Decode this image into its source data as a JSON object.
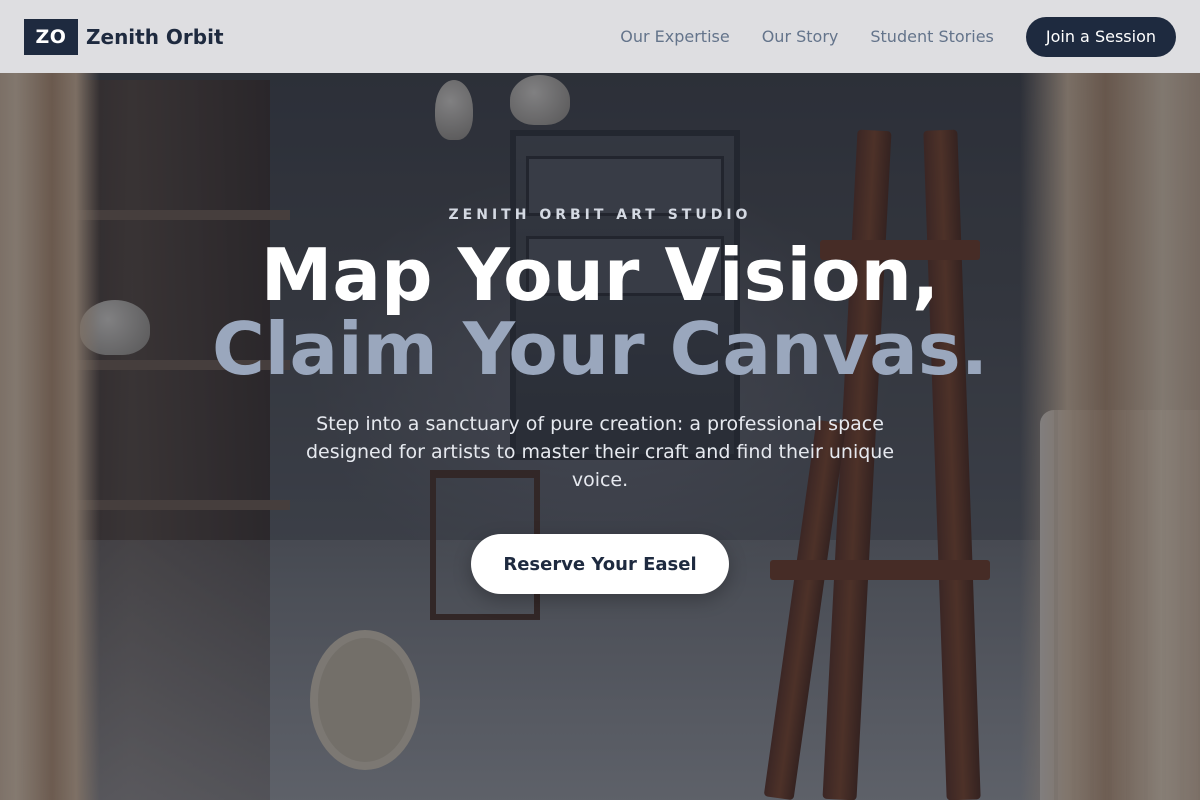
{
  "header": {
    "logo_mark": "ZO",
    "brand_name": "Zenith Orbit",
    "nav": [
      {
        "label": "Our Expertise"
      },
      {
        "label": "Our Story"
      },
      {
        "label": "Student Stories"
      }
    ],
    "cta_label": "Join a Session"
  },
  "hero": {
    "eyebrow": "ZENITH ORBIT ART STUDIO",
    "headline_line1": "Map Your Vision,",
    "headline_line2": "Claim Your Canvas.",
    "subcopy": "Step into a sanctuary of pure creation: a professional space designed for artists to master their craft and find their unique voice.",
    "cta_label": "Reserve Your Easel"
  },
  "colors": {
    "brand_navy": "#1e2a3f",
    "nav_text": "#64748b",
    "headline_accent": "#9aa7bd",
    "overlay": "#161c2d"
  }
}
